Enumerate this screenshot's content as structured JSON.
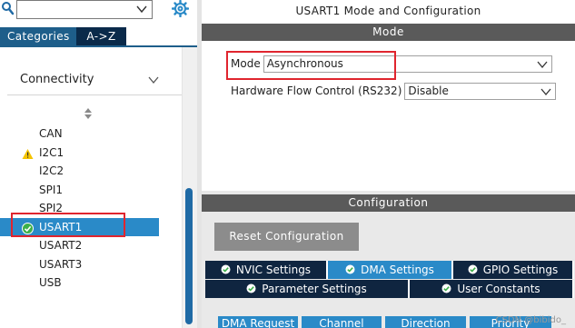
{
  "search": {
    "value": "",
    "placeholder": ""
  },
  "left_tabs": [
    {
      "label": "Categories"
    },
    {
      "label": "A->Z"
    }
  ],
  "category": {
    "label": "Connectivity"
  },
  "peripherals": [
    {
      "label": "CAN",
      "status": "none",
      "selected": false
    },
    {
      "label": "I2C1",
      "status": "warning",
      "selected": false
    },
    {
      "label": "I2C2",
      "status": "none",
      "selected": false
    },
    {
      "label": "SPI1",
      "status": "none",
      "selected": false
    },
    {
      "label": "SPI2",
      "status": "none",
      "selected": false
    },
    {
      "label": "USART1",
      "status": "ok",
      "selected": true
    },
    {
      "label": "USART2",
      "status": "none",
      "selected": false
    },
    {
      "label": "USART3",
      "status": "none",
      "selected": false
    },
    {
      "label": "USB",
      "status": "none",
      "selected": false
    }
  ],
  "right": {
    "title": "USART1 Mode and Configuration",
    "mode_section": "Mode",
    "mode": {
      "label": "Mode",
      "value": "Asynchronous"
    },
    "flow_control": {
      "label": "Hardware Flow Control (RS232)",
      "value": "Disable"
    },
    "config_section": "Configuration",
    "reset_button": "Reset Configuration",
    "settings_tabs_row1": [
      {
        "label": "NVIC Settings",
        "active": false
      },
      {
        "label": "DMA Settings",
        "active": true
      },
      {
        "label": "GPIO Settings",
        "active": false
      }
    ],
    "settings_tabs_row2": [
      {
        "label": "Parameter Settings",
        "active": false
      },
      {
        "label": "User Constants",
        "active": false
      }
    ],
    "dma_columns": [
      "DMA Request",
      "Channel",
      "Direction",
      "Priority"
    ]
  },
  "watermark": "CSDN @bibido_",
  "colors": {
    "tab_active": "#1e5e8a",
    "tab_inactive": "#0a2a4a",
    "selection": "#2a8ac8",
    "section_bar": "#5a5a5a",
    "dark_tab": "#0f2540",
    "highlight_box": "#e0252e",
    "warning": "#f5c400",
    "ok": "#3cb04a"
  }
}
